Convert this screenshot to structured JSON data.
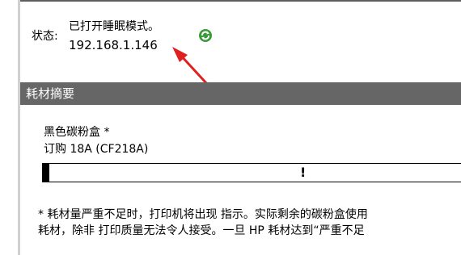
{
  "status": {
    "label": "状态:",
    "text": "已打开睡眠模式。",
    "ip": "192.168.1.146"
  },
  "icons": {
    "refresh": "refresh-icon",
    "annotation_arrow": "arrow-icon"
  },
  "colors": {
    "section_header_bg": "#666666",
    "refresh_green": "#3a9a3a",
    "arrow_red": "#e02020"
  },
  "supplies": {
    "section_title": "耗材摘要",
    "item": {
      "name": "黑色碳粉盒 *",
      "order": "订购 18A (CF218A)",
      "level_fraction": 0.015,
      "warning_mark": "!"
    },
    "note_line1": "* 耗材量严重不足时，打印机将出现 指示。实际剩余的碳粉盒使用",
    "note_line2": "耗材，除非 打印质量无法令人接受。一旦 HP 耗材达到“严重不足"
  }
}
